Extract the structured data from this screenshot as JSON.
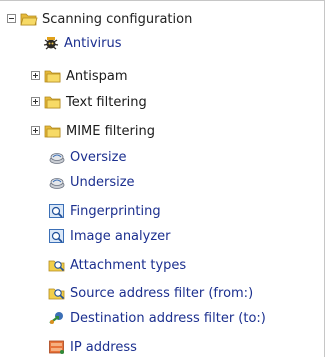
{
  "tree": {
    "root": {
      "label": "Scanning configuration",
      "icon": "folder-open-icon",
      "expanded": true
    },
    "items": [
      {
        "label": "Antivirus",
        "icon": "virus-bug-icon",
        "has_children": false
      },
      {
        "label": "Antispam",
        "icon": "folder-icon",
        "has_children": true
      },
      {
        "label": "Text filtering",
        "icon": "folder-icon",
        "has_children": true
      },
      {
        "label": "MIME filtering",
        "icon": "folder-icon",
        "has_children": true
      },
      {
        "label": "Oversize",
        "icon": "scale-icon",
        "has_children": false
      },
      {
        "label": "Undersize",
        "icon": "scale-icon",
        "has_children": false
      },
      {
        "label": "Fingerprinting",
        "icon": "magnifier-doc-icon",
        "has_children": false
      },
      {
        "label": "Image analyzer",
        "icon": "magnifier-doc-icon",
        "has_children": false
      },
      {
        "label": "Attachment types",
        "icon": "attachment-search-icon",
        "has_children": false
      },
      {
        "label": "Source address filter (from:)",
        "icon": "attachment-search-icon",
        "has_children": false
      },
      {
        "label": "Destination address filter (to:)",
        "icon": "destination-arrow-icon",
        "has_children": false
      },
      {
        "label": "IP address",
        "icon": "ip-address-icon",
        "has_children": false
      }
    ]
  },
  "colors": {
    "link": "#1b2f8f",
    "folder": "#f2cf4a",
    "border": "#c6c6c6"
  }
}
